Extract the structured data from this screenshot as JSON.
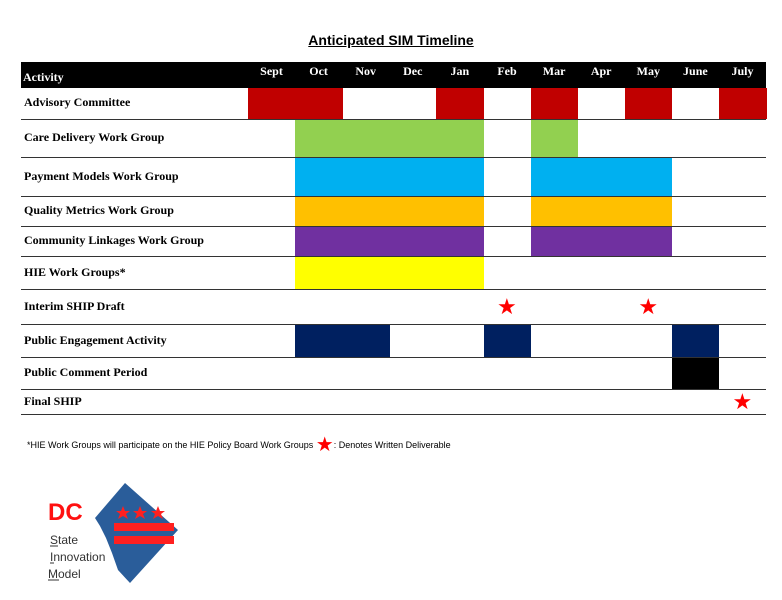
{
  "title": "Anticipated SIM Timeline",
  "header": {
    "activity_label": "Activity",
    "months": [
      "Sept",
      "Oct",
      "Nov",
      "Dec",
      "Jan",
      "Feb",
      "Mar",
      "Apr",
      "May",
      "June",
      "July"
    ]
  },
  "colors": {
    "advisory": "#c00000",
    "care": "#92d050",
    "payment": "#00b0f0",
    "quality": "#ffc000",
    "community": "#7030a0",
    "hie": "#ffff00",
    "engagement": "#002060",
    "comment": "#000000",
    "star": "#ff0000"
  },
  "rows": [
    {
      "label": "Advisory Committee",
      "color_key": "advisory",
      "filled_months": [
        "Sept",
        "Oct",
        "Jan",
        "Mar",
        "May",
        "July"
      ],
      "stars": []
    },
    {
      "label": "Care Delivery Work Group",
      "color_key": "care",
      "filled_months": [
        "Oct",
        "Nov",
        "Dec",
        "Jan",
        "Mar"
      ],
      "stars": []
    },
    {
      "label": "Payment Models Work Group",
      "color_key": "payment",
      "filled_months": [
        "Oct",
        "Nov",
        "Dec",
        "Jan",
        "Mar",
        "Apr",
        "May"
      ],
      "stars": []
    },
    {
      "label": "Quality Metrics Work Group",
      "color_key": "quality",
      "filled_months": [
        "Oct",
        "Nov",
        "Dec",
        "Jan",
        "Mar",
        "Apr",
        "May"
      ],
      "stars": []
    },
    {
      "label": "Community Linkages Work Group",
      "color_key": "community",
      "filled_months": [
        "Oct",
        "Nov",
        "Dec",
        "Jan",
        "Mar",
        "Apr",
        "May"
      ],
      "stars": []
    },
    {
      "label": "HIE Work Groups*",
      "color_key": "hie",
      "filled_months": [
        "Oct",
        "Nov",
        "Dec",
        "Jan"
      ],
      "stars": []
    },
    {
      "label": "Interim SHIP Draft",
      "color_key": null,
      "filled_months": [],
      "stars": [
        "Feb",
        "May"
      ]
    },
    {
      "label": "Public Engagement Activity",
      "color_key": "engagement",
      "filled_months": [
        "Oct",
        "Nov",
        "Feb",
        "June"
      ],
      "stars": []
    },
    {
      "label": "Public Comment Period",
      "color_key": "comment",
      "filled_months": [
        "June"
      ],
      "stars": []
    },
    {
      "label": "Final SHIP",
      "color_key": null,
      "filled_months": [],
      "stars": [
        "July"
      ]
    }
  ],
  "footnote": {
    "text": "*HIE Work Groups will participate on the HIE Policy Board Work Groups",
    "star_icon": "★",
    "legend_text": ": Denotes Written Deliverable"
  },
  "logo": {
    "dc": "DC",
    "line1": "State",
    "line2": "Innovation",
    "line3": "Model"
  }
}
